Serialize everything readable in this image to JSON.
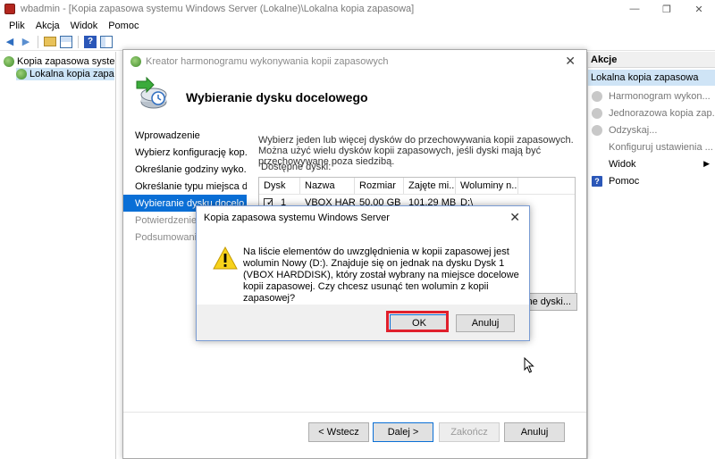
{
  "window": {
    "title": "wbadmin - [Kopia zapasowa systemu Windows Server (Lokalne)\\Lokalna kopia zapasowa]",
    "minimize_glyph": "—",
    "restore_glyph": "❐",
    "close_glyph": "✕"
  },
  "menu": [
    "Plik",
    "Akcja",
    "Widok",
    "Pomoc"
  ],
  "toolbar_icons": [
    "back-arrow-icon",
    "forward-arrow-icon",
    "folder-icon",
    "grid-icon",
    "help-icon",
    "panel-icon"
  ],
  "tree": {
    "items": [
      {
        "label": "Kopia zapasowa systemu W"
      },
      {
        "label": "Lokalna kopia zapasow"
      }
    ]
  },
  "actions": {
    "header": "Akcje",
    "section": "Lokalna kopia zapasowa",
    "items": [
      {
        "label": "Harmonogram wykon...",
        "icon": "schedule-icon"
      },
      {
        "label": "Jednorazowa kopia zap...",
        "icon": "backup-once-icon"
      },
      {
        "label": "Odzyskaj...",
        "icon": "recover-icon"
      },
      {
        "label": "Konfiguruj ustawienia ...",
        "icon": "settings-icon"
      },
      {
        "label": "Widok",
        "icon": "none"
      },
      {
        "label": "Pomoc",
        "icon": "help-icon"
      }
    ]
  },
  "wizard": {
    "title": "Kreator harmonogramu wykonywania kopii zapasowych",
    "heading": "Wybieranie dysku docelowego",
    "steps": [
      {
        "label": "Wprowadzenie",
        "state": "done"
      },
      {
        "label": "Wybierz konfigurację kop...",
        "state": "done"
      },
      {
        "label": "Określanie godziny wyko...",
        "state": "done"
      },
      {
        "label": "Określanie typu miejsca d...",
        "state": "done"
      },
      {
        "label": "Wybieranie dysku docelo...",
        "state": "active"
      },
      {
        "label": "Potwierdzenie",
        "state": "pending"
      },
      {
        "label": "Podsumowanie",
        "state": "pending"
      }
    ],
    "description": "Wybierz jeden lub więcej dysków do przechowywania kopii zapasowych. Można użyć wielu dysków kopii zapasowych, jeśli dyski mają być przechowywane poza siedzibą.",
    "disks_label": "Dostępne dyski:",
    "table": {
      "columns": [
        "Dysk",
        "Nazwa",
        "Rozmiar",
        "Zajęte mi...",
        "Woluminy n..."
      ],
      "rows": [
        {
          "dysk": "1",
          "nazwa": "VBOX HAR...",
          "rozmiar": "50,00 GB",
          "zajete": "101,29 MB",
          "woluminy": "D:\\",
          "checked": true
        }
      ]
    },
    "show_all_button": "ne dyski...",
    "buttons": {
      "back": "< Wstecz",
      "next": "Dalej >",
      "finish": "Zakończ",
      "cancel": "Anuluj"
    }
  },
  "dialog": {
    "title": "Kopia zapasowa systemu Windows Server",
    "message": "Na liście elementów do uwzględnienia w kopii zapasowej jest wolumin Nowy (D:). Znajduje się on jednak na dysku Dysk 1 (VBOX HARDDISK), który został wybrany na miejsce docelowe kopii zapasowej. Czy chcesz usunąć ten wolumin z kopii zapasowej?",
    "ok": "OK",
    "cancel": "Anuluj",
    "close_glyph": "✕",
    "highlight_color": "#e0202c"
  }
}
